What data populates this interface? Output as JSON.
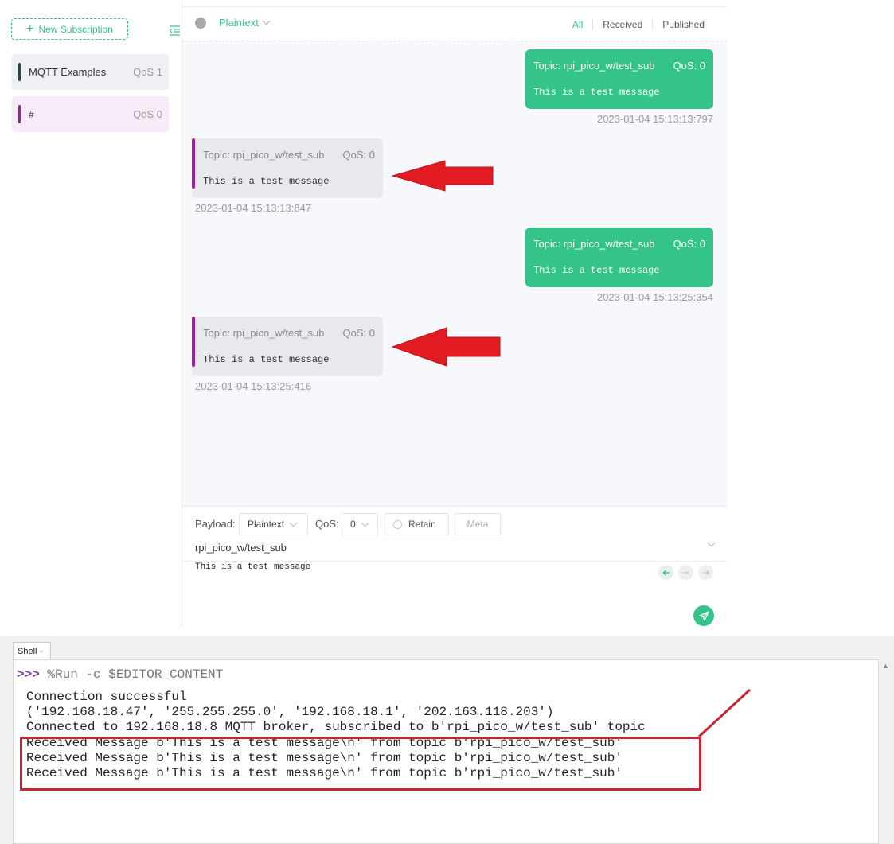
{
  "sidebar": {
    "new_subscription": "New Subscription",
    "subscriptions": [
      {
        "topic": "MQTT Examples",
        "qos": "QoS 1",
        "color": "#1b4d54"
      },
      {
        "topic": "#",
        "qos": "QoS 0",
        "color": "#a31bab"
      }
    ]
  },
  "topbar": {
    "format": "Plaintext",
    "filters": [
      "All",
      "Received",
      "Published"
    ]
  },
  "messages": [
    {
      "direction": "published",
      "topic": "Topic: rpi_pico_w/test_sub",
      "qos": "QoS: 0",
      "payload": "This is a test message",
      "time": "2023-01-04 15:13:13:797"
    },
    {
      "direction": "received",
      "topic": "Topic: rpi_pico_w/test_sub",
      "qos": "QoS: 0",
      "payload": "This is a test message",
      "time": "2023-01-04 15:13:13:847"
    },
    {
      "direction": "published",
      "topic": "Topic: rpi_pico_w/test_sub",
      "qos": "QoS: 0",
      "payload": "This is a test message",
      "time": "2023-01-04 15:13:25:354"
    },
    {
      "direction": "received",
      "topic": "Topic: rpi_pico_w/test_sub",
      "qos": "QoS: 0",
      "payload": "This is a test message",
      "time": "2023-01-04 15:13:25:416"
    }
  ],
  "composer": {
    "payload_label": "Payload:",
    "payload_format": "Plaintext",
    "qos_label": "QoS:",
    "qos_value": "0",
    "retain": "Retain",
    "meta": "Meta",
    "topic": "rpi_pico_w/test_sub",
    "payload": "This is a test message"
  },
  "shell": {
    "tab": "Shell",
    "tab_close": "×",
    "prompt": ">>>",
    "command": " %Run -c $EDITOR_CONTENT",
    "lines": [
      "Connection successful",
      "('192.168.18.47', '255.255.255.0', '192.168.18.1', '202.163.118.203')",
      "Connected to 192.168.18.8 MQTT broker, subscribed to b'rpi_pico_w/test_sub' topic",
      "Received Message b'This is a test message\\n' from topic b'rpi_pico_w/test_sub'",
      "Received Message b'This is a test message\\n' from topic b'rpi_pico_w/test_sub'",
      "Received Message b'This is a test message\\n' from topic b'rpi_pico_w/test_sub'"
    ]
  },
  "colors": {
    "accent": "#34c388",
    "received_bar": "#a31bab",
    "annotation_red": "#e31c23",
    "highlight_box": "#c5262f"
  }
}
